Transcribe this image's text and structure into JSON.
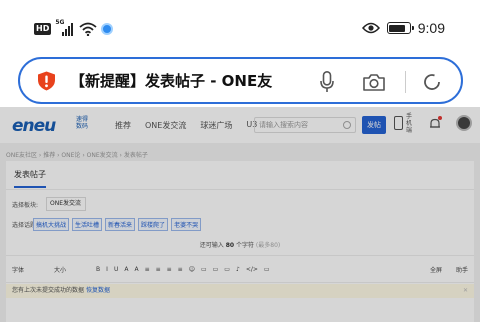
{
  "status_bar": {
    "network_badge": "HD",
    "network_gen": "5G",
    "time": "9:09",
    "icons": [
      "hd-icon",
      "signal-icon",
      "wifi-icon",
      "app-notification-icon",
      "eye-icon",
      "battery-icon"
    ]
  },
  "url_bar": {
    "title": "【新提醒】发表帖子 - ONE友",
    "icons": [
      "shield-icon",
      "mic-icon",
      "camera-icon",
      "reload-icon"
    ],
    "accent_color": "#2d6ed8"
  },
  "site": {
    "logo_text": "eneu",
    "logo_sub": "速得 数码",
    "nav_items": [
      "推荐",
      "ONE发交流",
      "球迷广场",
      "U3"
    ],
    "search_placeholder": "请输入搜索内容",
    "search_button": "发帖",
    "phone_label": "手机端",
    "breadcrumb": "ONE友社区 › 推荐 › ONE论 › ONE发交流 › 发表帖子",
    "tab_label": "发表帖子",
    "section_label": "选择板块:",
    "section_value": "ONE发交流",
    "topic_label": "选择话题:",
    "topics": [
      "搞机大挑战",
      "生活吐槽",
      "新春活来",
      "踩楼爬了",
      "老婆不哭"
    ],
    "count_prefix": "还可输入",
    "count_value": "80",
    "count_suffix": "个字符",
    "count_hint": "(最多80)",
    "toolbar_left": [
      "字体",
      "大小",
      "B",
      "I",
      "U",
      "A",
      "A",
      "≡",
      "≡",
      "≡",
      "≡",
      "☺",
      "▭",
      "▭",
      "▭",
      "♪",
      "</>",
      "▭"
    ],
    "toolbar_right": [
      "全屏",
      "助手"
    ],
    "draft_text": "您有上次未提交成功的数据",
    "draft_link": "恢复数据",
    "brand_color": "#2563d4"
  }
}
